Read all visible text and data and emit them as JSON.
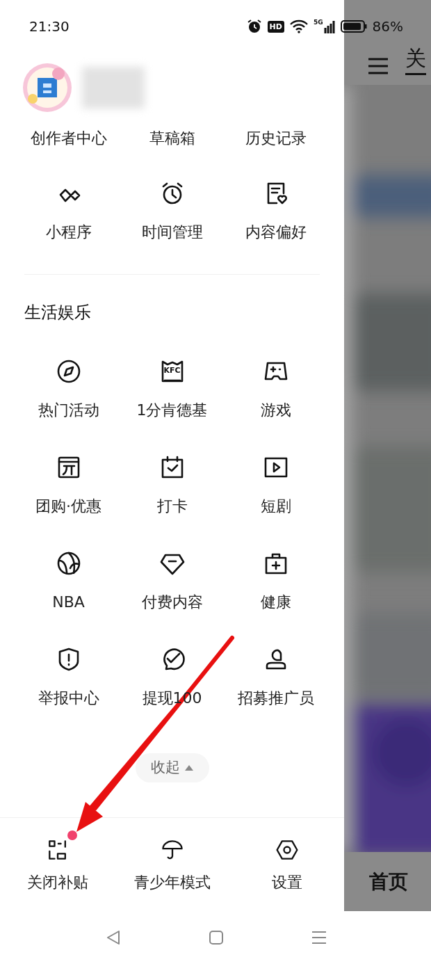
{
  "status_bar": {
    "time": "21:30",
    "hd_badge": "HD",
    "network": "5G",
    "battery": "86%"
  },
  "quick_links": [
    "创作者中心",
    "草稿箱",
    "历史记录"
  ],
  "tools": [
    {
      "label": "小程序"
    },
    {
      "label": "时间管理"
    },
    {
      "label": "内容偏好"
    }
  ],
  "section_title": "生活娱乐",
  "bucket_icon_text": "KFC",
  "entertainment": [
    {
      "label": "热门活动"
    },
    {
      "label": "1分肯德基"
    },
    {
      "label": "游戏"
    },
    {
      "label": "团购·优惠"
    },
    {
      "label": "打卡"
    },
    {
      "label": "短剧"
    },
    {
      "label": "NBA"
    },
    {
      "label": "付费内容"
    },
    {
      "label": "健康"
    },
    {
      "label": "举报中心"
    },
    {
      "label": "提现100"
    },
    {
      "label": "招募推广员"
    }
  ],
  "collapse_button": {
    "label": "收起"
  },
  "bottom_actions": [
    {
      "label": "关闭补贴",
      "badge": true
    },
    {
      "label": "青少年模式",
      "badge": false
    },
    {
      "label": "设置",
      "badge": false
    }
  ],
  "background_app": {
    "header_text": "关",
    "tab_label": "首页"
  }
}
